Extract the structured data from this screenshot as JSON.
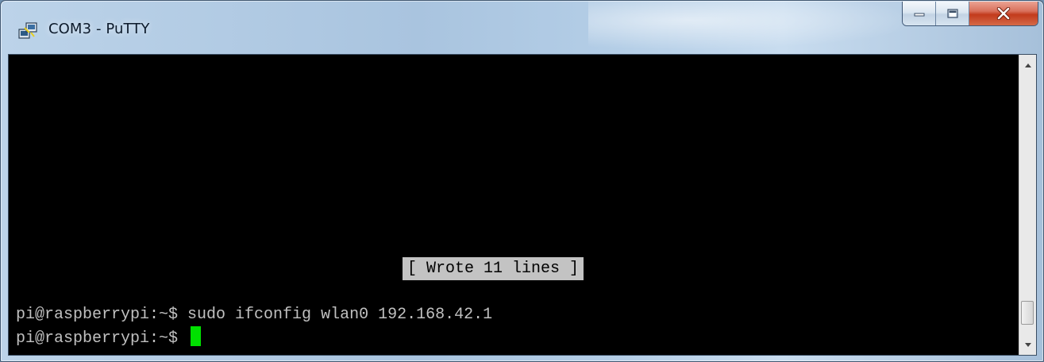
{
  "window": {
    "title": "COM3 - PuTTY",
    "icons": {
      "app": "putty-icon",
      "minimize": "minimize-icon",
      "maximize": "maximize-icon",
      "close": "close-icon"
    },
    "colors": {
      "close_button": "#c74323",
      "title_glass": "#b3cde6"
    }
  },
  "terminal": {
    "status_message": "[ Wrote 11 lines ]",
    "lines": [
      "pi@raspberrypi:~$ sudo ifconfig wlan0 192.168.42.1",
      "pi@raspberrypi:~$ "
    ],
    "colors": {
      "background": "#000000",
      "text": "#c0c0c0",
      "cursor": "#00e000",
      "status_bg": "#c3c3c3"
    }
  },
  "scrollbar": {
    "up_icon": "arrow-up-icon",
    "down_icon": "arrow-down-icon"
  }
}
